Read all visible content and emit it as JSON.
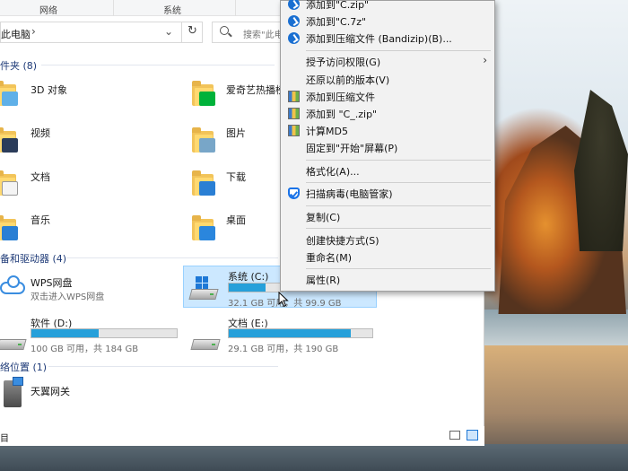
{
  "ribbon": {
    "tab_network": "网络",
    "tab_system": "系统"
  },
  "address": {
    "path": "此电脑",
    "chevron": "›",
    "dropdown": "⌄",
    "refresh": "↻"
  },
  "search": {
    "placeholder": "搜索\"此电脑\""
  },
  "groups": {
    "folders": {
      "header": "件夹 (8)"
    },
    "devices": {
      "header": "备和驱动器 (4)"
    },
    "network": {
      "header": "络位置 (1)"
    }
  },
  "folders": [
    {
      "label": "3D 对象"
    },
    {
      "label": "爱奇艺热播榜"
    },
    {
      "label": "视频"
    },
    {
      "label": "图片"
    },
    {
      "label": "文档"
    },
    {
      "label": "下载"
    },
    {
      "label": "音乐"
    },
    {
      "label": "桌面"
    }
  ],
  "devices": [
    {
      "label": "WPS网盘",
      "sub": "双击进入WPS网盘"
    },
    {
      "label": "系统 (C:)",
      "sub": "32.1 GB 可用，共 99.9 GB",
      "used_fraction": 0.68
    },
    {
      "label": "软件 (D:)",
      "sub": "100 GB 可用，共 184 GB",
      "used_fraction": 0.46
    },
    {
      "label": "文档 (E:)",
      "sub": "29.1 GB 可用，共 190 GB",
      "used_fraction": 0.85
    }
  ],
  "network_items": [
    {
      "label": "天翼网关"
    }
  ],
  "status": {
    "count": "目"
  },
  "context_menu": {
    "items": [
      {
        "label": "添加到\"C.zip\"",
        "icon": "bandizip-icon"
      },
      {
        "label": "添加到\"C.7z\"",
        "icon": "bandizip-icon"
      },
      {
        "label": "添加到压缩文件 (Bandizip)(B)...",
        "icon": "bandizip-icon"
      },
      {
        "label": "授予访问权限(G)",
        "submenu": "›"
      },
      {
        "label": "还原以前的版本(V)"
      },
      {
        "label": "添加到压缩文件",
        "icon": "winrar-icon"
      },
      {
        "label": "添加到 \"C_.zip\"",
        "icon": "winrar-icon"
      },
      {
        "label": "计算MD5",
        "icon": "winrar-icon"
      },
      {
        "label": "固定到\"开始\"屏幕(P)"
      },
      {
        "label": "格式化(A)..."
      },
      {
        "label": "扫描病毒(电脑管家)",
        "icon": "shield-icon"
      },
      {
        "label": "复制(C)"
      },
      {
        "label": "创建快捷方式(S)"
      },
      {
        "label": "重命名(M)"
      },
      {
        "label": "属性(R)"
      }
    ]
  },
  "colors": {
    "accent": "#26a0da",
    "selection": "#cce8ff",
    "header_text": "#1f3b78"
  }
}
